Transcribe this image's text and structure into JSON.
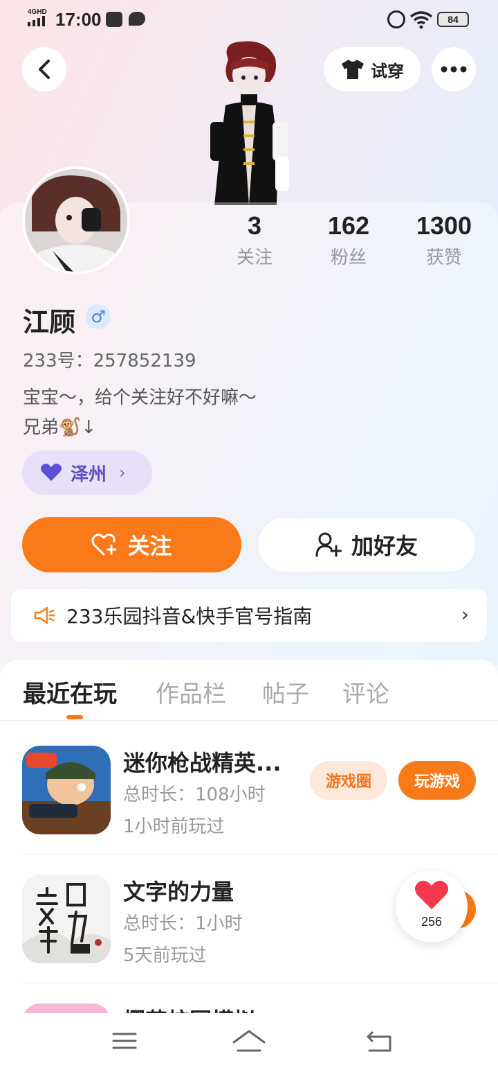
{
  "status_bar": {
    "network": "4GHD",
    "time": "17:00",
    "battery": "84"
  },
  "header": {
    "try_on_label": "试穿"
  },
  "profile": {
    "name": "江顾",
    "gender_symbol": "♂",
    "uid_line": "233号：257852139",
    "bio_line1": "宝宝～，给个关注好不好嘛～",
    "bio_line2": "兄弟🐒↓",
    "cp_tag": "泽州",
    "stats": [
      {
        "value": "3",
        "label": "关注"
      },
      {
        "value": "162",
        "label": "粉丝"
      },
      {
        "value": "1300",
        "label": "获赞"
      }
    ]
  },
  "actions": {
    "follow_label": "关注",
    "add_friend_label": "加好友"
  },
  "notice": {
    "text": "233乐园抖音&快手官号指南"
  },
  "tabs": [
    {
      "label": "最近在玩",
      "active": true
    },
    {
      "label": "作品栏",
      "active": false
    },
    {
      "label": "帖子",
      "active": false
    },
    {
      "label": "评论",
      "active": false
    }
  ],
  "games": [
    {
      "title": "迷你枪战精英...",
      "duration": "总时长：108小时",
      "last_played": "1小时前玩过",
      "circle_label": "游戏圈",
      "play_label": "玩游戏"
    },
    {
      "title": "文字的力量",
      "duration": "总时长：1小时",
      "last_played": "5天前玩过"
    },
    {
      "title": "樱花校园模拟"
    }
  ],
  "like_float": {
    "count": "256"
  },
  "colors": {
    "accent": "#fa7a1a",
    "cp_tag_bg": "#e7e0f6",
    "cp_tag_text": "#5d4fbf"
  }
}
